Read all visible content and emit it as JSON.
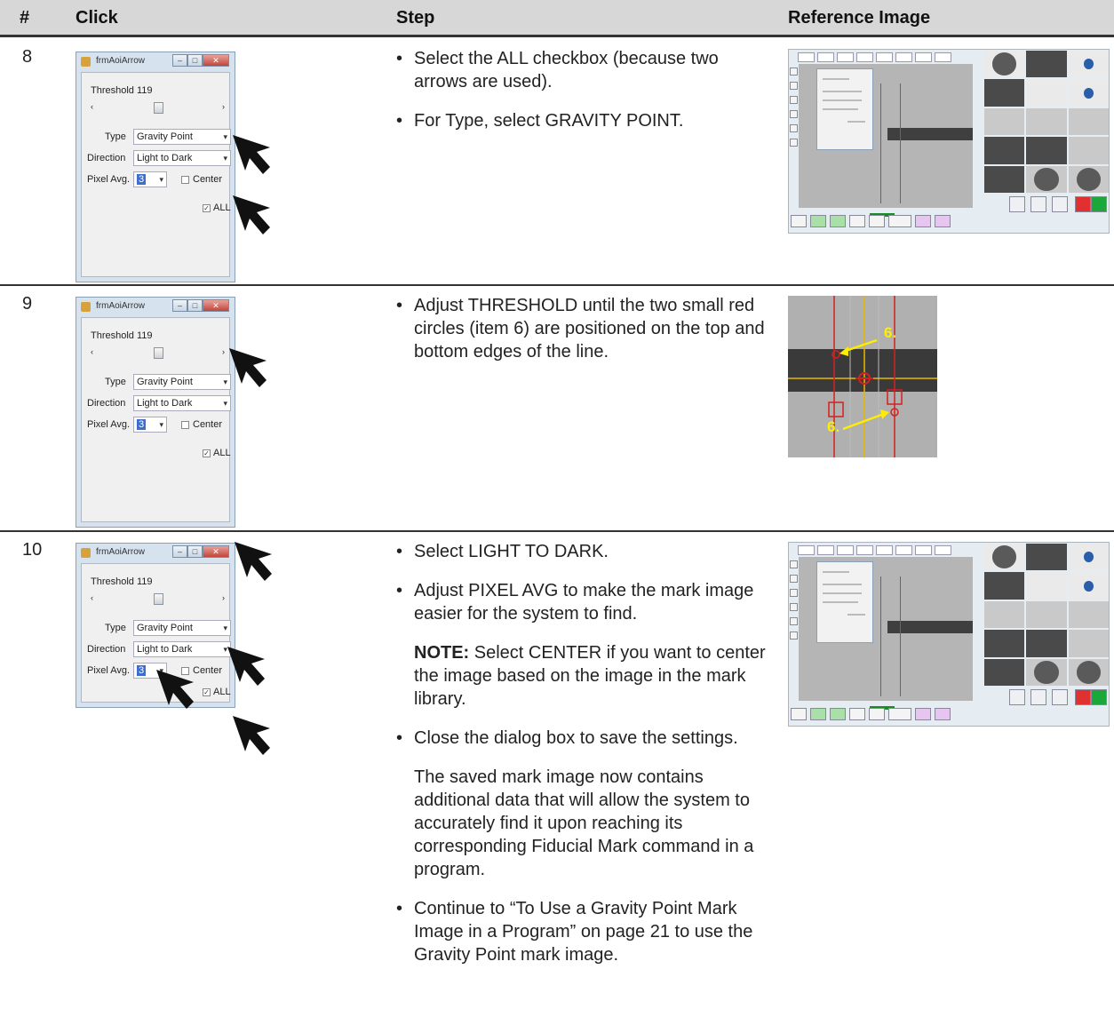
{
  "header": {
    "num": "#",
    "click": "Click",
    "step": "Step",
    "ref": "Reference Image"
  },
  "dialog": {
    "title": "frmAoiArrow",
    "threshold_label": "Threshold",
    "threshold_value": "119",
    "type_label": "Type",
    "type_value": "Gravity Point",
    "direction_label": "Direction",
    "direction_value": "Light to Dark",
    "pixel_label": "Pixel Avg.",
    "pixel_value": "3",
    "center_label": "Center",
    "all_label": "ALL"
  },
  "rows": [
    {
      "num": "8",
      "b1": "Select the ALL checkbox (because two arrows are used).",
      "b2": "For Type, select GRAVITY POINT."
    },
    {
      "num": "9",
      "b1": "Adjust THRESHOLD until the two small red circles (item 6) are positioned on the top and bottom edges of the line.",
      "callout": "6."
    },
    {
      "num": "10",
      "b1": "Select LIGHT TO DARK.",
      "b2": "Adjust PIXEL AVG to make the mark image easier for the system to find.",
      "note_label": "NOTE:",
      "note_text": " Select CENTER if you want to center the image based on the image in the mark library.",
      "b3": "Close the dialog box to save the settings.",
      "para": "The saved mark image now contains additional data that will allow the system to accurately find it upon reaching its corresponding Fiducial Mark command in a program.",
      "b4": "Continue to “To Use a Gravity Point Mark Image in a Program” on page 21 to use the Gravity Point mark image."
    }
  ]
}
